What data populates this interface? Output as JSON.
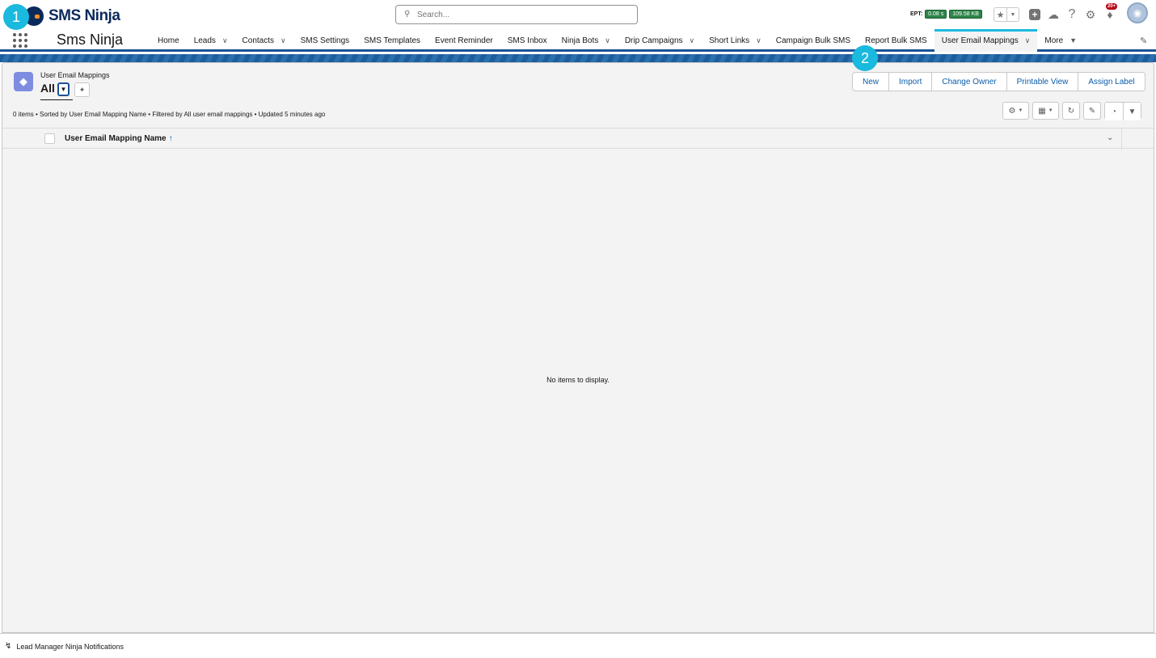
{
  "annotations": {
    "badge1": "1",
    "badge2": "2"
  },
  "header": {
    "logo_text": "SMS Ninja",
    "search_placeholder": "Search...",
    "ept_label": "EPT:",
    "ept_time": "0.08 s",
    "ept_size": "109.58 KB",
    "notification_count": "20+"
  },
  "nav": {
    "app_name": "Sms Ninja",
    "items": [
      {
        "label": "Home",
        "dropdown": false
      },
      {
        "label": "Leads",
        "dropdown": true
      },
      {
        "label": "Contacts",
        "dropdown": true
      },
      {
        "label": "SMS Settings",
        "dropdown": false
      },
      {
        "label": "SMS Templates",
        "dropdown": false
      },
      {
        "label": "Event Reminder",
        "dropdown": false
      },
      {
        "label": "SMS Inbox",
        "dropdown": false
      },
      {
        "label": "Ninja Bots",
        "dropdown": true
      },
      {
        "label": "Drip Campaigns",
        "dropdown": true
      },
      {
        "label": "Short Links",
        "dropdown": true
      },
      {
        "label": "Campaign Bulk SMS",
        "dropdown": false
      },
      {
        "label": "Report Bulk SMS",
        "dropdown": false
      },
      {
        "label": "User Email Mappings",
        "dropdown": true,
        "active": true
      },
      {
        "label": "More",
        "dropdown": true
      }
    ]
  },
  "list_view": {
    "object_label": "User Email Mappings",
    "view_name": "All",
    "info": "0 items • Sorted by User Email Mapping Name • Filtered by All user email mappings • Updated 5 minutes ago",
    "actions": [
      "New",
      "Import",
      "Change Owner",
      "Printable View",
      "Assign Label"
    ],
    "column_header": "User Email Mapping Name",
    "sort_arrow": "↑",
    "empty_message": "No items to display."
  },
  "utility_bar": {
    "item_label": "Lead Manager Ninja Notifications"
  },
  "colors": {
    "brand_navy": "#0b2a5b",
    "accent_cyan": "#1ab9de",
    "link_blue": "#0b5cab",
    "object_icon": "#7f8de1"
  }
}
